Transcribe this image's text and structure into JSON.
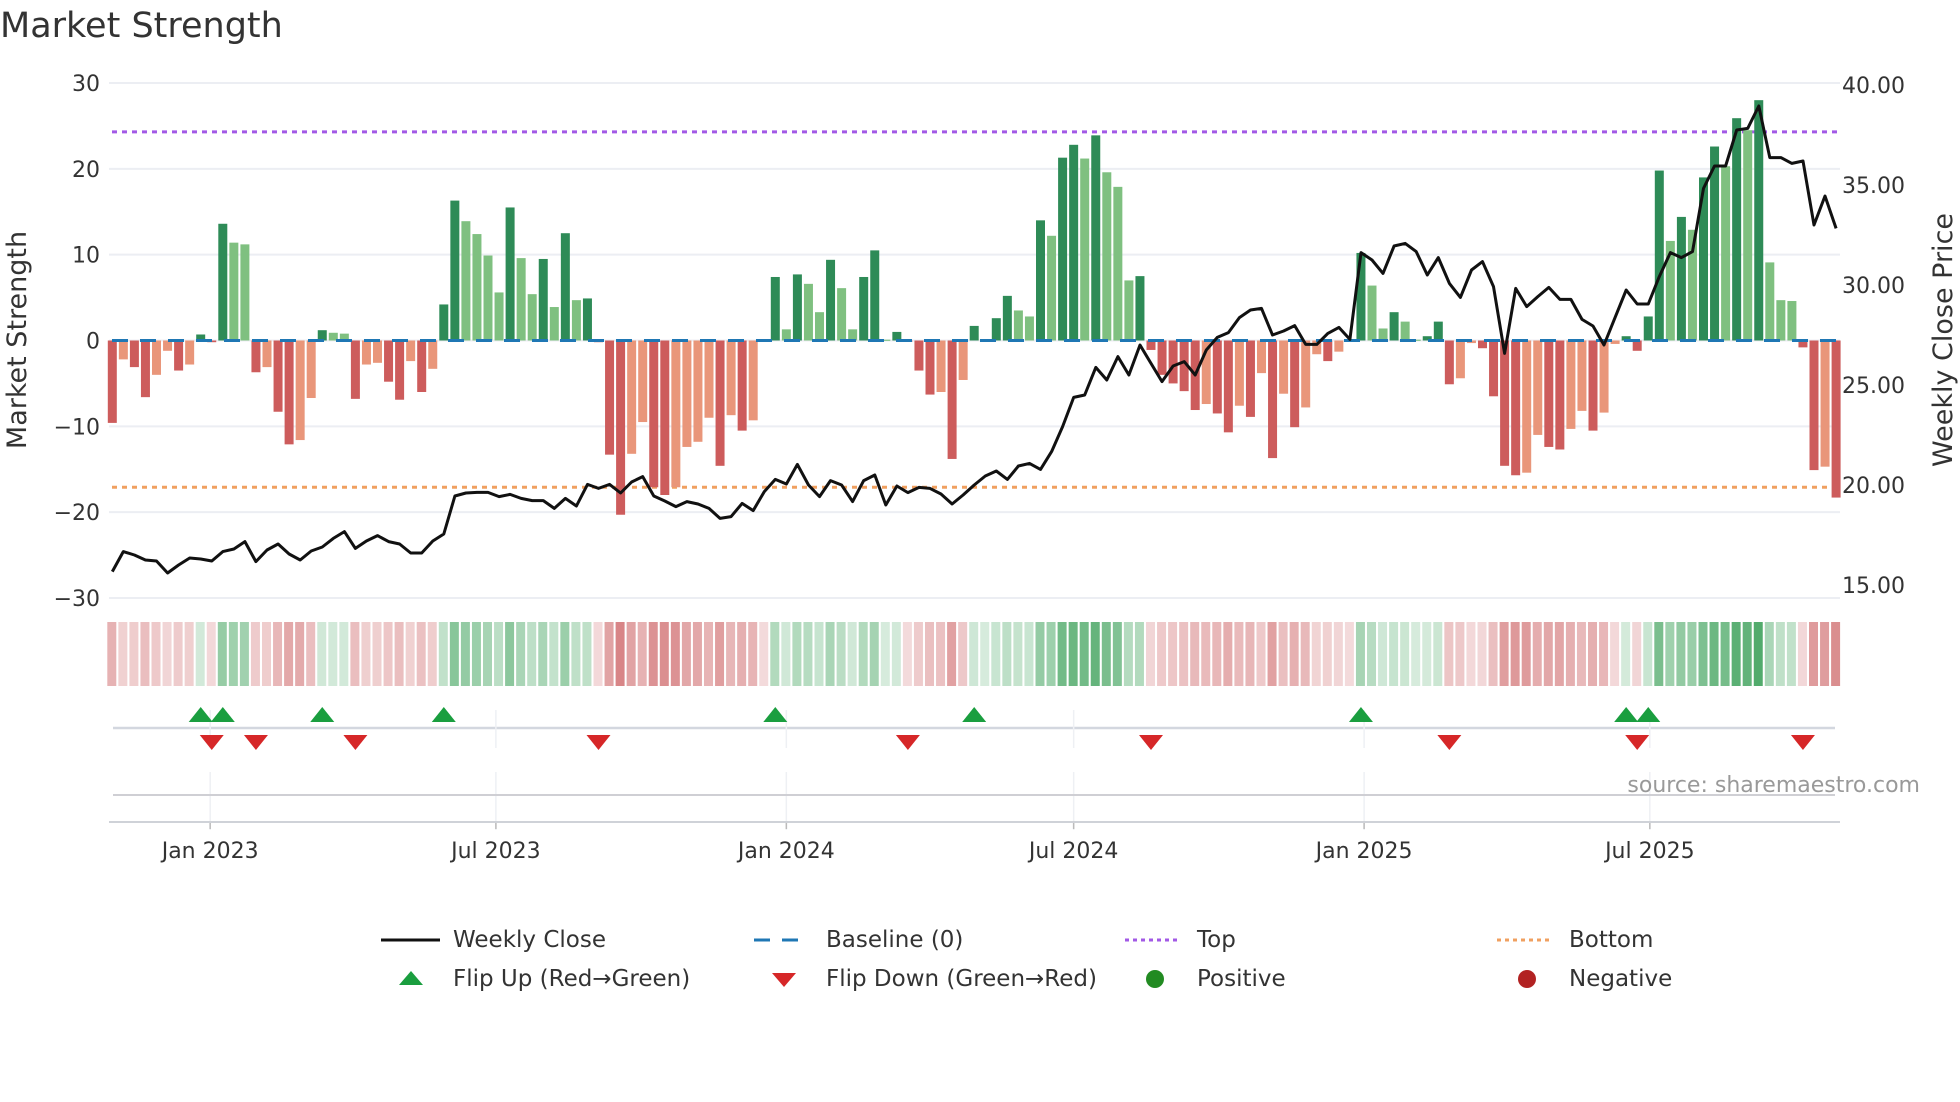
{
  "title": "Market Strength",
  "source": "source: sharemaestro.com",
  "colors": {
    "pos_dark": "#2e8b57",
    "pos_light": "#7fc080",
    "neg_dark": "#cd5c5c",
    "neg_light": "#e9967a",
    "baseline": "#1f77b4",
    "top": "#a259e6",
    "bottom": "#f0a060",
    "price": "#111111",
    "flip_up": "#1a9e3f",
    "flip_down": "#d62728",
    "positive": "#228b22",
    "negative": "#b22222"
  },
  "chart_data": {
    "type": "bar+line",
    "title": "Market Strength",
    "start_date": "2022-10-31",
    "frequency": "weekly",
    "ylabel": "Market Strength",
    "ylabel_right": "Weekly Close Price",
    "ylim": [
      -30,
      30
    ],
    "ylim_right": [
      14.35,
      40.1
    ],
    "yticks": [
      30,
      20,
      10,
      0,
      -10,
      -20,
      -30
    ],
    "yticks_labels": [
      "30",
      "20",
      "10",
      "0",
      "−10",
      "−20",
      "−30"
    ],
    "yticks_right": [
      40,
      35,
      30,
      25,
      20,
      15
    ],
    "yticks_right_labels": [
      "40.00",
      "35.00",
      "30.00",
      "25.00",
      "20.00",
      "15.00"
    ],
    "xticks": [
      {
        "date": "2023-01-01",
        "label": "Jan 2023"
      },
      {
        "date": "2023-07-01",
        "label": "Jul 2023"
      },
      {
        "date": "2024-01-01",
        "label": "Jan 2024"
      },
      {
        "date": "2024-07-01",
        "label": "Jul 2024"
      },
      {
        "date": "2025-01-01",
        "label": "Jan 2025"
      },
      {
        "date": "2025-07-01",
        "label": "Jul 2025"
      }
    ],
    "top_level": 24.3,
    "bottom_level": -17.1,
    "baseline": 0,
    "grid": true,
    "strength": [
      -9.6,
      -2.2,
      -3.1,
      -6.6,
      -4.0,
      -1.2,
      -3.5,
      -2.8,
      0.7,
      -0.2,
      13.6,
      11.4,
      11.2,
      -3.7,
      -3.1,
      -8.3,
      -12.1,
      -11.6,
      -6.7,
      1.2,
      0.9,
      0.8,
      -6.8,
      -2.8,
      -2.6,
      -4.8,
      -6.9,
      -2.4,
      -6.0,
      -3.3,
      4.2,
      16.3,
      13.9,
      12.4,
      9.9,
      5.6,
      15.5,
      9.6,
      5.4,
      9.5,
      3.9,
      12.5,
      4.7,
      4.9,
      -0.2,
      -13.3,
      -20.3,
      -13.2,
      -9.5,
      -17.1,
      -18.0,
      -17.1,
      -12.4,
      -11.8,
      -9.0,
      -14.6,
      -8.7,
      -10.5,
      -9.3,
      -0.1,
      7.4,
      1.3,
      7.7,
      6.6,
      3.3,
      9.4,
      6.1,
      1.3,
      7.4,
      10.5,
      0.1,
      1.0,
      -0.1,
      -3.5,
      -6.3,
      -6.0,
      -13.8,
      -4.6,
      1.7,
      0.1,
      2.6,
      5.2,
      3.5,
      2.8,
      14.0,
      12.2,
      21.3,
      22.8,
      21.2,
      23.9,
      19.6,
      17.9,
      7.0,
      7.5,
      -1.1,
      -4.0,
      -5.0,
      -5.9,
      -8.1,
      -7.4,
      -8.5,
      -10.7,
      -7.6,
      -8.9,
      -3.8,
      -13.7,
      -6.2,
      -10.1,
      -7.8,
      -1.6,
      -2.4,
      -1.3,
      -0.1,
      10.2,
      6.4,
      1.4,
      3.3,
      2.2,
      0.1,
      0.5,
      2.2,
      -5.1,
      -4.4,
      -0.3,
      -0.9,
      -6.5,
      -14.6,
      -15.7,
      -15.4,
      -11.0,
      -12.4,
      -12.7,
      -10.3,
      -8.2,
      -10.5,
      -8.4,
      -0.4,
      0.5,
      -1.2,
      2.8,
      19.8,
      11.6,
      14.4,
      12.9,
      19.0,
      22.6,
      20.3,
      25.9,
      24.5,
      28.0,
      9.1,
      4.7,
      4.6,
      -0.8,
      -15.1,
      -14.7,
      -18.3
    ],
    "weekly_close": [
      15.67,
      16.67,
      16.5,
      16.25,
      16.2,
      15.6,
      16.0,
      16.35,
      16.3,
      16.2,
      16.67,
      16.8,
      17.17,
      16.17,
      16.75,
      17.05,
      16.55,
      16.25,
      16.7,
      16.9,
      17.33,
      17.67,
      16.83,
      17.2,
      17.47,
      17.17,
      17.05,
      16.6,
      16.6,
      17.2,
      17.55,
      19.45,
      19.6,
      19.63,
      19.63,
      19.42,
      19.53,
      19.33,
      19.22,
      19.22,
      18.83,
      19.33,
      18.95,
      20.03,
      19.83,
      20.03,
      19.6,
      20.15,
      20.42,
      19.45,
      19.2,
      18.92,
      19.17,
      19.05,
      18.83,
      18.33,
      18.42,
      19.08,
      18.72,
      19.67,
      20.28,
      20.05,
      21.03,
      20.0,
      19.42,
      20.22,
      20.0,
      19.17,
      20.22,
      20.5,
      19.0,
      19.95,
      19.62,
      19.88,
      19.83,
      19.55,
      19.05,
      19.5,
      20.0,
      20.45,
      20.7,
      20.28,
      20.95,
      21.08,
      20.78,
      21.67,
      22.92,
      24.38,
      24.5,
      25.88,
      25.25,
      26.42,
      25.5,
      27.0,
      26.08,
      25.17,
      25.95,
      26.17,
      25.5,
      26.75,
      27.38,
      27.62,
      28.37,
      28.75,
      28.83,
      27.5,
      27.7,
      27.97,
      27.03,
      27.03,
      27.58,
      27.88,
      27.28,
      31.62,
      31.25,
      30.58,
      31.95,
      32.08,
      31.67,
      30.5,
      31.37,
      30.08,
      29.38,
      30.75,
      31.17,
      29.92,
      26.58,
      29.83,
      28.92,
      29.42,
      29.88,
      29.28,
      29.28,
      28.28,
      27.95,
      27.0,
      28.38,
      29.75,
      29.05,
      29.05,
      30.42,
      31.62,
      31.37,
      31.67,
      34.83,
      35.95,
      35.95,
      37.75,
      37.83,
      38.95,
      36.37,
      36.37,
      36.08,
      36.2,
      33.0,
      34.45,
      32.83
    ],
    "legend": {
      "placement": "bottom",
      "items": [
        {
          "key": "close",
          "label": "Weekly Close"
        },
        {
          "key": "baseline",
          "label": "Baseline (0)"
        },
        {
          "key": "top",
          "label": "Top"
        },
        {
          "key": "bottom",
          "label": "Bottom"
        },
        {
          "key": "flip_up",
          "label": "Flip Up (Red→Green)"
        },
        {
          "key": "flip_down",
          "label": "Flip Down (Green→Red)"
        },
        {
          "key": "positive",
          "label": "Positive"
        },
        {
          "key": "negative",
          "label": "Negative"
        }
      ]
    }
  }
}
